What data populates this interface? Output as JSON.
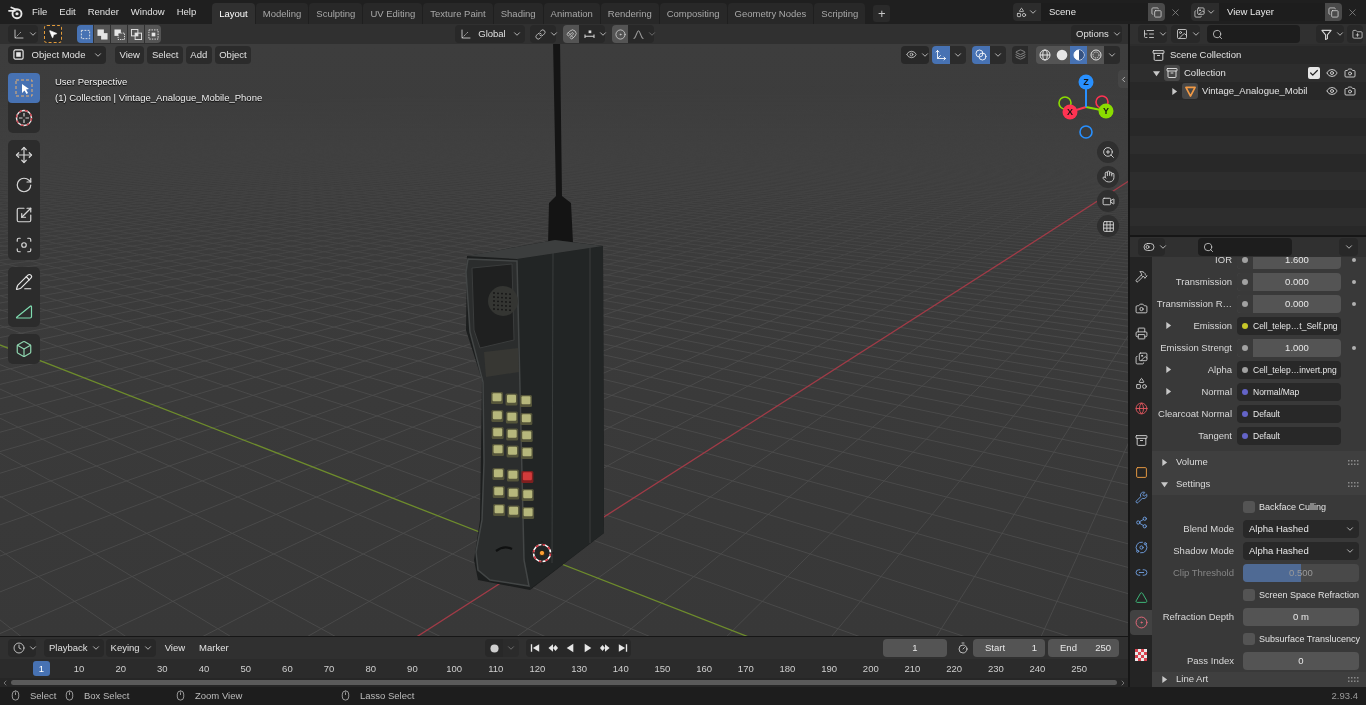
{
  "top_bar": {
    "menus": [
      "File",
      "Edit",
      "Render",
      "Window",
      "Help"
    ],
    "workspaces": [
      {
        "label": "Layout",
        "selected": true
      },
      {
        "label": "Modeling",
        "selected": false
      },
      {
        "label": "Sculpting",
        "selected": false
      },
      {
        "label": "UV Editing",
        "selected": false
      },
      {
        "label": "Texture Paint",
        "selected": false
      },
      {
        "label": "Shading",
        "selected": false
      },
      {
        "label": "Animation",
        "selected": false
      },
      {
        "label": "Rendering",
        "selected": false
      },
      {
        "label": "Compositing",
        "selected": false
      },
      {
        "label": "Geometry Nodes",
        "selected": false
      },
      {
        "label": "Scripting",
        "selected": false
      }
    ],
    "add_workspace": "+",
    "scene": "Scene",
    "view_layer": "View Layer"
  },
  "tool_header": {
    "select_modes": [
      {
        "kind": "set",
        "selected": true
      },
      {
        "kind": "extend",
        "selected": false
      },
      {
        "kind": "subtract",
        "selected": false
      },
      {
        "kind": "difference",
        "selected": false
      },
      {
        "kind": "intersect",
        "selected": false
      }
    ],
    "orientation": "Global",
    "options": "Options"
  },
  "viewport": {
    "mode": "Object Mode",
    "menus": [
      "View",
      "Select",
      "Add",
      "Object"
    ],
    "gizmos": {
      "on": true
    },
    "overlays": {
      "on": true
    },
    "xray": {
      "on": false
    },
    "shading": [
      {
        "kind": "wireframe",
        "selected": false
      },
      {
        "kind": "solid",
        "selected": false
      },
      {
        "kind": "material",
        "selected": true
      },
      {
        "kind": "rendered",
        "selected": false
      }
    ],
    "toolbar": [
      {
        "tools": [
          {
            "kind": "select_box",
            "selected": true
          },
          {
            "kind": "cursor",
            "selected": false
          }
        ]
      },
      {
        "tools": [
          {
            "kind": "move",
            "selected": false
          },
          {
            "kind": "rotate",
            "selected": false
          },
          {
            "kind": "scale",
            "selected": false
          },
          {
            "kind": "transform",
            "selected": false
          }
        ]
      },
      {
        "tools": [
          {
            "kind": "annotate",
            "selected": false
          },
          {
            "kind": "measure",
            "selected": false
          }
        ]
      },
      {
        "tools": [
          {
            "kind": "add_cube",
            "selected": false
          }
        ]
      }
    ],
    "view_name": "User Perspective",
    "object_info": "(1) Collection | Vintage_Analogue_Mobile_Phone",
    "gizmo_axes": [
      {
        "kind": "x",
        "label": "X",
        "color": "#ff3352"
      },
      {
        "kind": "y",
        "label": "Y",
        "color": "#8bdc00"
      },
      {
        "kind": "z",
        "label": "Z",
        "color": "#2890ff"
      }
    ]
  },
  "timeline": {
    "menus": [
      {
        "kind": "dropdown",
        "label": "Playback"
      },
      {
        "kind": "dropdown",
        "label": "Keying"
      },
      {
        "kind": "menu",
        "label": "View"
      },
      {
        "kind": "menu",
        "label": "Marker"
      }
    ],
    "auto_keying": {
      "on": false
    },
    "current_frame": "1",
    "start": {
      "label": "Start",
      "value": "1"
    },
    "end": {
      "label": "End",
      "value": "250"
    },
    "playhead": "1",
    "ruler": [
      "10",
      "20",
      "30",
      "40",
      "50",
      "60",
      "70",
      "80",
      "90",
      "100",
      "110",
      "120",
      "130",
      "140",
      "150",
      "160",
      "170",
      "180",
      "190",
      "200",
      "210",
      "220",
      "230",
      "240",
      "250"
    ]
  },
  "outliner": {
    "tree": [
      {
        "kind": "scene_collection",
        "label": "Scene Collection",
        "children": [
          {
            "kind": "collection",
            "label": "Collection",
            "expanded": true,
            "checked": true,
            "children": [
              {
                "kind": "mesh_object",
                "label": "Vintage_Analogue_Mobil",
                "expanded": false
              }
            ]
          }
        ]
      }
    ]
  },
  "properties": {
    "tab_groups": [
      {
        "tabs": [
          {
            "kind": "tool",
            "selected": false
          }
        ]
      },
      {
        "tabs": [
          {
            "kind": "render",
            "selected": false
          },
          {
            "kind": "output",
            "selected": false
          },
          {
            "kind": "view_layer",
            "selected": false
          },
          {
            "kind": "scene",
            "selected": false
          },
          {
            "kind": "world",
            "selected": false
          }
        ]
      },
      {
        "tabs": [
          {
            "kind": "collection",
            "selected": false
          }
        ]
      },
      {
        "tabs": [
          {
            "kind": "object",
            "selected": false
          },
          {
            "kind": "modifiers",
            "selected": false
          },
          {
            "kind": "particles",
            "selected": false
          },
          {
            "kind": "physics",
            "selected": false
          },
          {
            "kind": "constraints",
            "selected": false
          },
          {
            "kind": "data",
            "selected": false
          },
          {
            "kind": "material",
            "selected": true
          }
        ]
      },
      {
        "tabs": [
          {
            "kind": "texture",
            "selected": false
          }
        ]
      }
    ],
    "inputs": [
      {
        "kind": "number",
        "label": "IOR",
        "value": "1.600",
        "color": "#a1a1a1",
        "decorator": true
      },
      {
        "kind": "number",
        "label": "Transmission",
        "value": "0.000",
        "color": "#a1a1a1",
        "decorator": true
      },
      {
        "kind": "number",
        "label": "Transmission R…",
        "value": "0.000",
        "color": "#a1a1a1",
        "decorator": true
      },
      {
        "kind": "link",
        "label": "Emission",
        "value": "Cell_telep…t_Self.png",
        "color": "#c7c729",
        "expanded": false,
        "decorator": false
      },
      {
        "kind": "number",
        "label": "Emission Strengt",
        "value": "1.000",
        "color": "#a1a1a1",
        "decorator": true
      },
      {
        "kind": "link",
        "label": "Alpha",
        "value": "Cell_telep…invert.png",
        "color": "#a1a1a1",
        "expanded": false,
        "decorator": false
      },
      {
        "kind": "link",
        "label": "Normal",
        "value": "Normal/Map",
        "color": "#6363c7",
        "expanded": false,
        "decorator": false
      },
      {
        "kind": "field",
        "label": "Clearcoat Normal",
        "value": "Default",
        "color": "#6363c7",
        "decorator": false
      },
      {
        "kind": "field",
        "label": "Tangent",
        "value": "Default",
        "color": "#6363c7",
        "decorator": false
      }
    ],
    "panels": [
      {
        "title": "Volume",
        "expanded": false
      },
      {
        "title": "Settings",
        "expanded": true,
        "rows": [
          {
            "kind": "checkbox",
            "label": "Backface Culling",
            "checked": false,
            "disabled": false
          },
          {
            "kind": "dropdown",
            "label": "Blend Mode",
            "value": "Alpha Hashed",
            "disabled": false
          },
          {
            "kind": "dropdown",
            "label": "Shadow Mode",
            "value": "Alpha Hashed",
            "disabled": false
          },
          {
            "kind": "slider",
            "label": "Clip Threshold",
            "value": "0.500",
            "level": 0.5,
            "disabled": true
          },
          {
            "kind": "checkbox",
            "label": "Screen Space Refraction",
            "checked": false,
            "disabled": false
          },
          {
            "kind": "number",
            "label": "Refraction Depth",
            "value": "0 m",
            "disabled": false
          },
          {
            "kind": "checkbox",
            "label": "Subsurface Translucency",
            "checked": false,
            "disabled": false
          },
          {
            "kind": "number",
            "label": "Pass Index",
            "value": "0",
            "disabled": false
          }
        ]
      },
      {
        "title": "Line Art",
        "expanded": false
      }
    ]
  },
  "status_bar": {
    "hints": [
      "Select",
      "Box Select",
      "Zoom View",
      "Lasso Select"
    ],
    "version": "2.93.4"
  }
}
